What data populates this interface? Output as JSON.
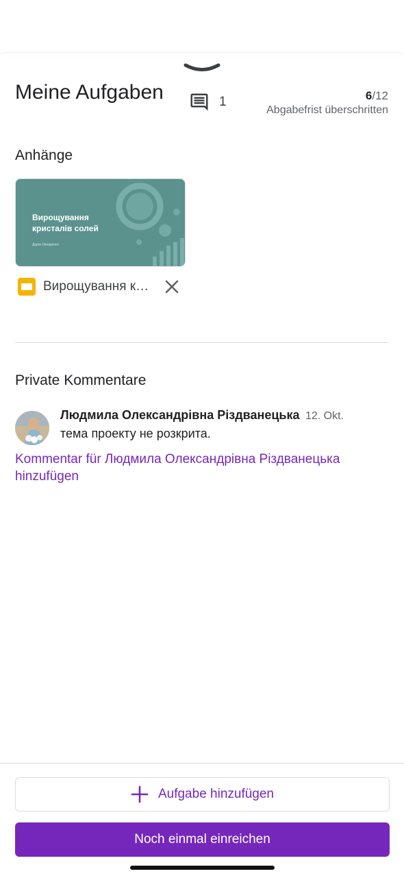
{
  "header": {
    "title": "Meine Aufgaben",
    "comment_count": "1",
    "score_earned": "6",
    "score_total": "/12",
    "status": "Abgabefrist überschritten"
  },
  "attachments": {
    "heading": "Anhänge",
    "items": [
      {
        "thumbnail_title": "Вирощування кристалів солей",
        "thumbnail_subtitle": "Дарія Овчаренко",
        "file_name": "Вирощування кристалів солей",
        "icon": "google-slides-icon"
      }
    ]
  },
  "private_comments": {
    "heading": "Private Kommentare",
    "items": [
      {
        "author": "Людмила Олександрівна Різдванецька",
        "date": "12. Okt.",
        "text": "тема проекту не розкрита."
      }
    ],
    "add_link": "Kommentar für Людмила Олександрівна Різдванецька hinzufügen"
  },
  "actions": {
    "add_label": "Aufgabe hinzufügen",
    "submit_label": "Noch einmal einreichen"
  },
  "colors": {
    "accent": "#7627bb",
    "thumbnail_bg": "#5b928e",
    "slides_icon": "#f4b400"
  }
}
